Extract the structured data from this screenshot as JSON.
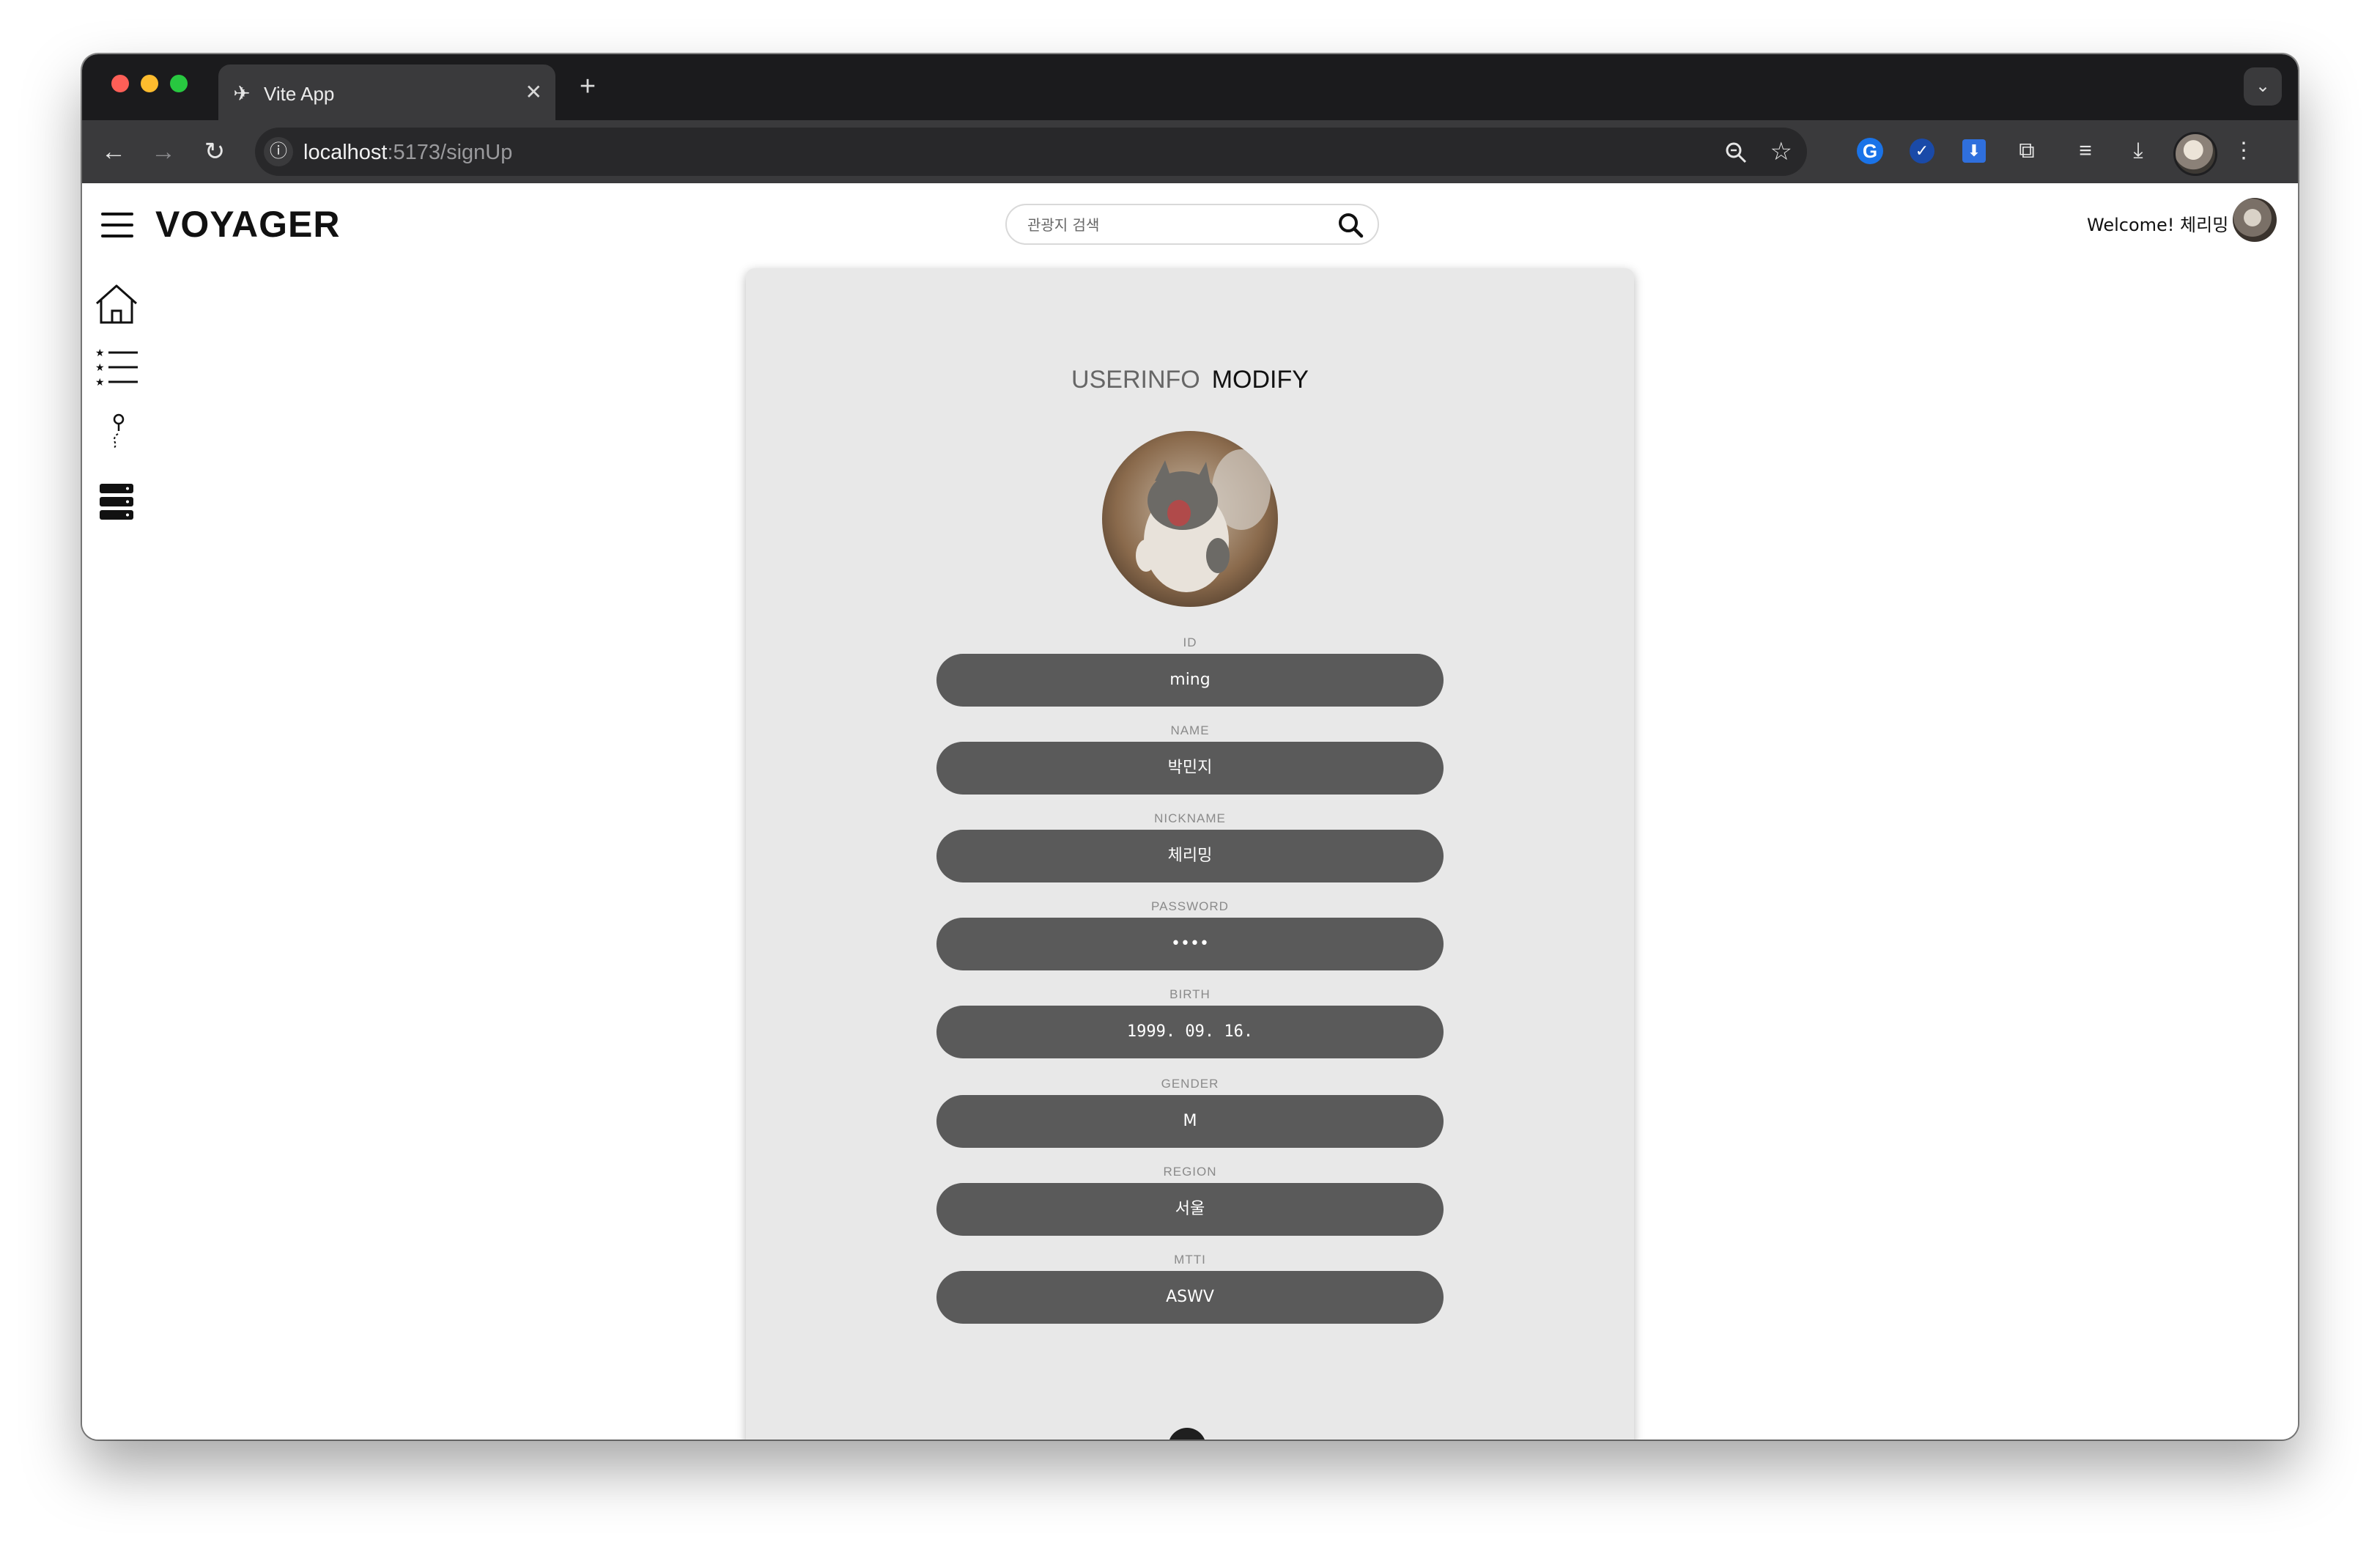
{
  "browser": {
    "tab_title": "Vite App",
    "tab_close": "✕",
    "new_tab": "+",
    "url_host": "localhost",
    "url_path": ":5173/signUp"
  },
  "header": {
    "logo": "VOYAGER",
    "search_placeholder": "관광지 검색",
    "welcome": "Welcome! 체리밍"
  },
  "card": {
    "title_left": "USERINFO",
    "title_right": "MODIFY",
    "fields": [
      {
        "label": "ID",
        "value": "ming"
      },
      {
        "label": "NAME",
        "value": "박민지"
      },
      {
        "label": "NICKNAME",
        "value": "체리밍"
      },
      {
        "label": "PASSWORD",
        "value": "••••"
      },
      {
        "label": "BIRTH",
        "value": "1999. 09. 16."
      },
      {
        "label": "GENDER",
        "value": "M"
      },
      {
        "label": "REGION",
        "value": "서울"
      },
      {
        "label": "MTTI",
        "value": "ASWV"
      }
    ],
    "scroll_button": "∨"
  },
  "icons": {
    "sidebar": [
      "home-icon",
      "list-icon",
      "location-pin-icon",
      "database-icon"
    ]
  },
  "colors": {
    "card_bg": "#e8e8e8",
    "pill_bg": "#5a5a5a",
    "browser_chrome": "#3a3a3c"
  }
}
